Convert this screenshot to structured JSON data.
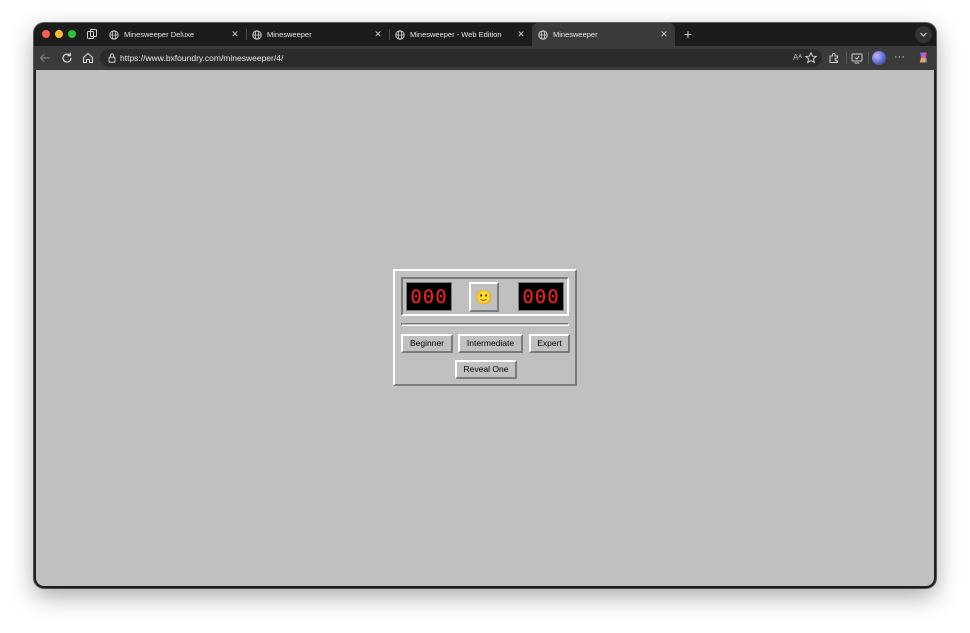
{
  "browser": {
    "tabs": [
      {
        "title": "Minesweeper Deluxe",
        "active": false
      },
      {
        "title": "Minesweeper",
        "active": false
      },
      {
        "title": "Minesweeper - Web Edition",
        "active": false
      },
      {
        "title": "Minesweeper",
        "active": true
      }
    ],
    "close_glyph": "✕",
    "new_tab_glyph": "+",
    "url": "https://www.bxfoundry.com/minesweeper/4/",
    "read_aloud_glyph": "Aᴬ",
    "more_glyph": "···"
  },
  "game": {
    "mine_counter": "000",
    "timer": "000",
    "face": "🙂",
    "buttons": {
      "beginner": "Beginner",
      "intermediate": "Intermediate",
      "expert": "Expert",
      "reveal_one": "Reveal One"
    }
  },
  "colors": {
    "page_background": "#c0c0c0",
    "lcd_digit": "#ff2020",
    "lcd_background": "#000000",
    "bevel_light": "#ffffff",
    "bevel_dark": "#7b7b7b"
  }
}
